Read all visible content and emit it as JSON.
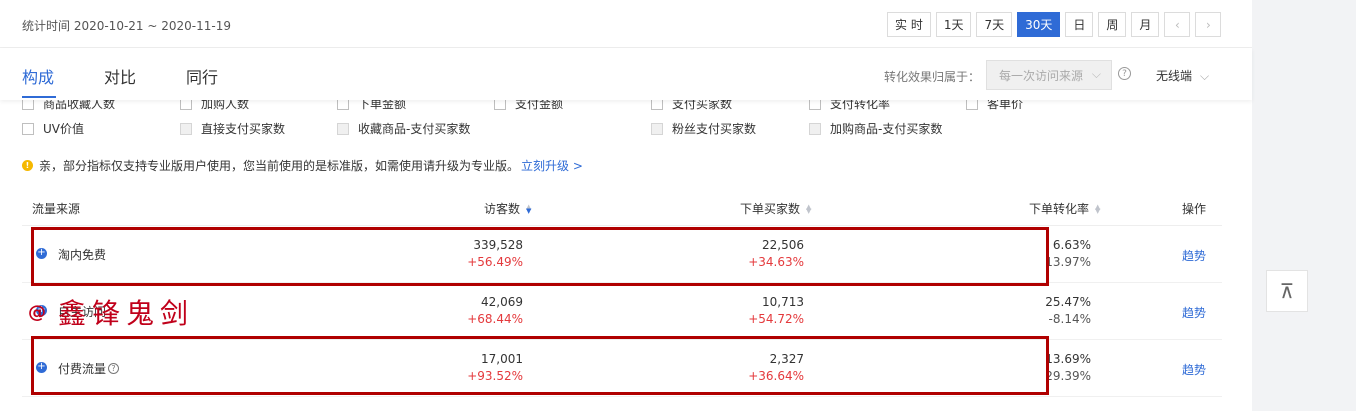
{
  "header": {
    "stat_time": "统计时间 2020-10-21 ~ 2020-11-19",
    "ranges": [
      "实 时",
      "1天",
      "7天",
      "30天",
      "日",
      "周",
      "月"
    ],
    "active_range": "30天"
  },
  "tabs": {
    "items": [
      "构成",
      "对比",
      "同行"
    ],
    "active": "构成"
  },
  "attribution": {
    "label": "转化效果归属于：",
    "value": "每一次访问来源",
    "device": "无线端"
  },
  "checkboxes": {
    "row1": [
      "商品收藏人数",
      "加购人数",
      "下单金额",
      "支付金额",
      "支付买家数",
      "支付转化率",
      "客单价"
    ],
    "row2": [
      "UV价值",
      "直接支付买家数",
      "收藏商品-支付买家数",
      "粉丝支付买家数",
      "加购商品-支付买家数"
    ]
  },
  "notice": {
    "text": "亲，部分指标仅支持专业版用户使用，您当前使用的是标准版，如需使用请升级为专业版。",
    "link": "立刻升级 >"
  },
  "table": {
    "headers": {
      "source": "流量来源",
      "visitors": "访客数",
      "buyers": "下单买家数",
      "conv": "下单转化率",
      "action": "操作"
    },
    "rows": [
      {
        "source": "淘内免费",
        "visitors": "339,528",
        "visitors_change": "+56.49%",
        "buyers": "22,506",
        "buyers_change": "+34.63%",
        "conv": "6.63%",
        "conv_change": "13.97%",
        "action": "趋势"
      },
      {
        "source": "自主访问",
        "visitors": "42,069",
        "visitors_change": "+68.44%",
        "buyers": "10,713",
        "buyers_change": "+54.72%",
        "conv": "25.47%",
        "conv_change": "-8.14%",
        "action": "趋势"
      },
      {
        "source": "付费流量",
        "visitors": "17,001",
        "visitors_change": "+93.52%",
        "buyers": "2,327",
        "buyers_change": "+36.64%",
        "conv": "13.69%",
        "conv_change": "29.39%",
        "action": "趋势"
      }
    ]
  },
  "watermark": {
    "at": "@",
    "text": "鑫锋鬼剑"
  },
  "back_top": "⊼",
  "colors": {
    "accent": "#2f6bd6",
    "positive": "#e4393c",
    "highlight": "#b00000"
  }
}
